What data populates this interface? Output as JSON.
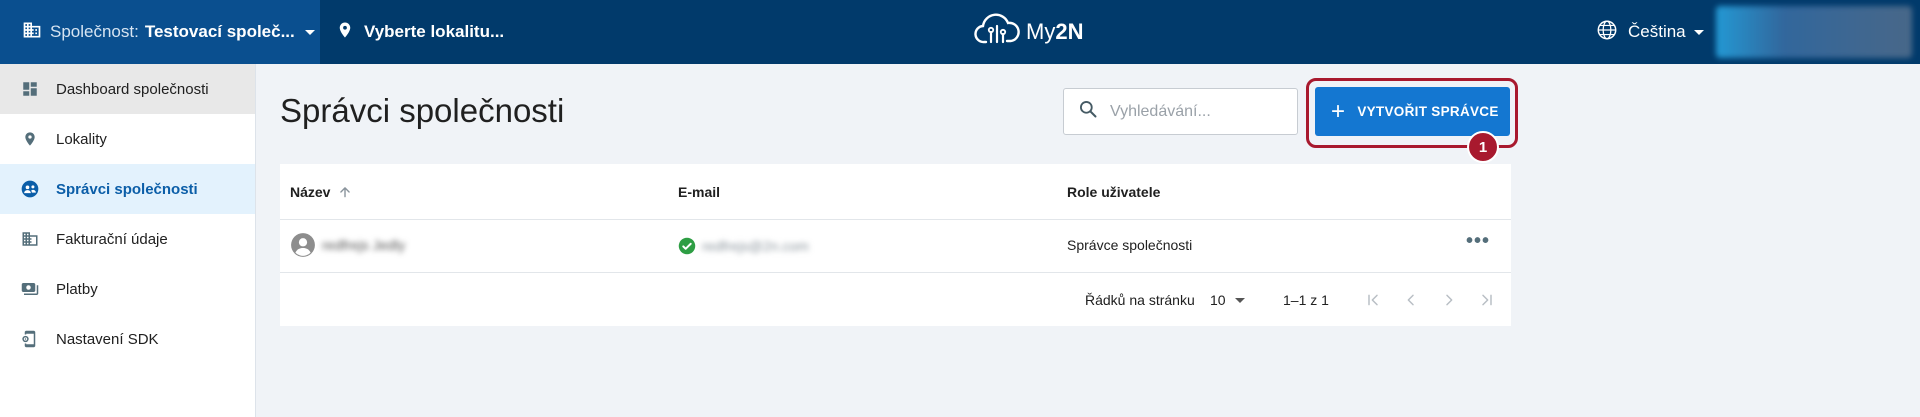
{
  "topbar": {
    "company_label": "Společnost:",
    "company_value": "Testovací společ...",
    "site_placeholder": "Vyberte lokalitu...",
    "logo_my": "My",
    "logo_2n": "2N",
    "language": "Čeština"
  },
  "sidebar": {
    "items": [
      {
        "label": "Dashboard společnosti",
        "icon": "dashboard-icon"
      },
      {
        "label": "Lokality",
        "icon": "location-pin-icon"
      },
      {
        "label": "Správci společnosti",
        "icon": "admins-icon"
      },
      {
        "label": "Fakturační údaje",
        "icon": "building-icon"
      },
      {
        "label": "Platby",
        "icon": "payments-icon"
      },
      {
        "label": "Nastavení SDK",
        "icon": "sdk-settings-icon"
      }
    ]
  },
  "main": {
    "title": "Správci společnosti",
    "search_placeholder": "Vyhledávání...",
    "create_label": "VYTVOŘIT SPRÁVCE",
    "badge_number": "1"
  },
  "table": {
    "columns": [
      "Název",
      "E-mail",
      "Role uživatele"
    ],
    "rows": [
      {
        "name": "redfrejs Jedly",
        "email": "redfrejs@2n.com",
        "role": "Správce společnosti"
      }
    ],
    "footer": {
      "rows_per_page_label": "Řádků na stránku",
      "rows_per_page_value": "10",
      "range": "1–1 z 1"
    }
  },
  "colors": {
    "topbar": "#013a6b",
    "company_bg": "#0a4f8f",
    "primary": "#1477d1",
    "highlight": "#a8192e",
    "active_item_bg": "#e3f2fd"
  }
}
